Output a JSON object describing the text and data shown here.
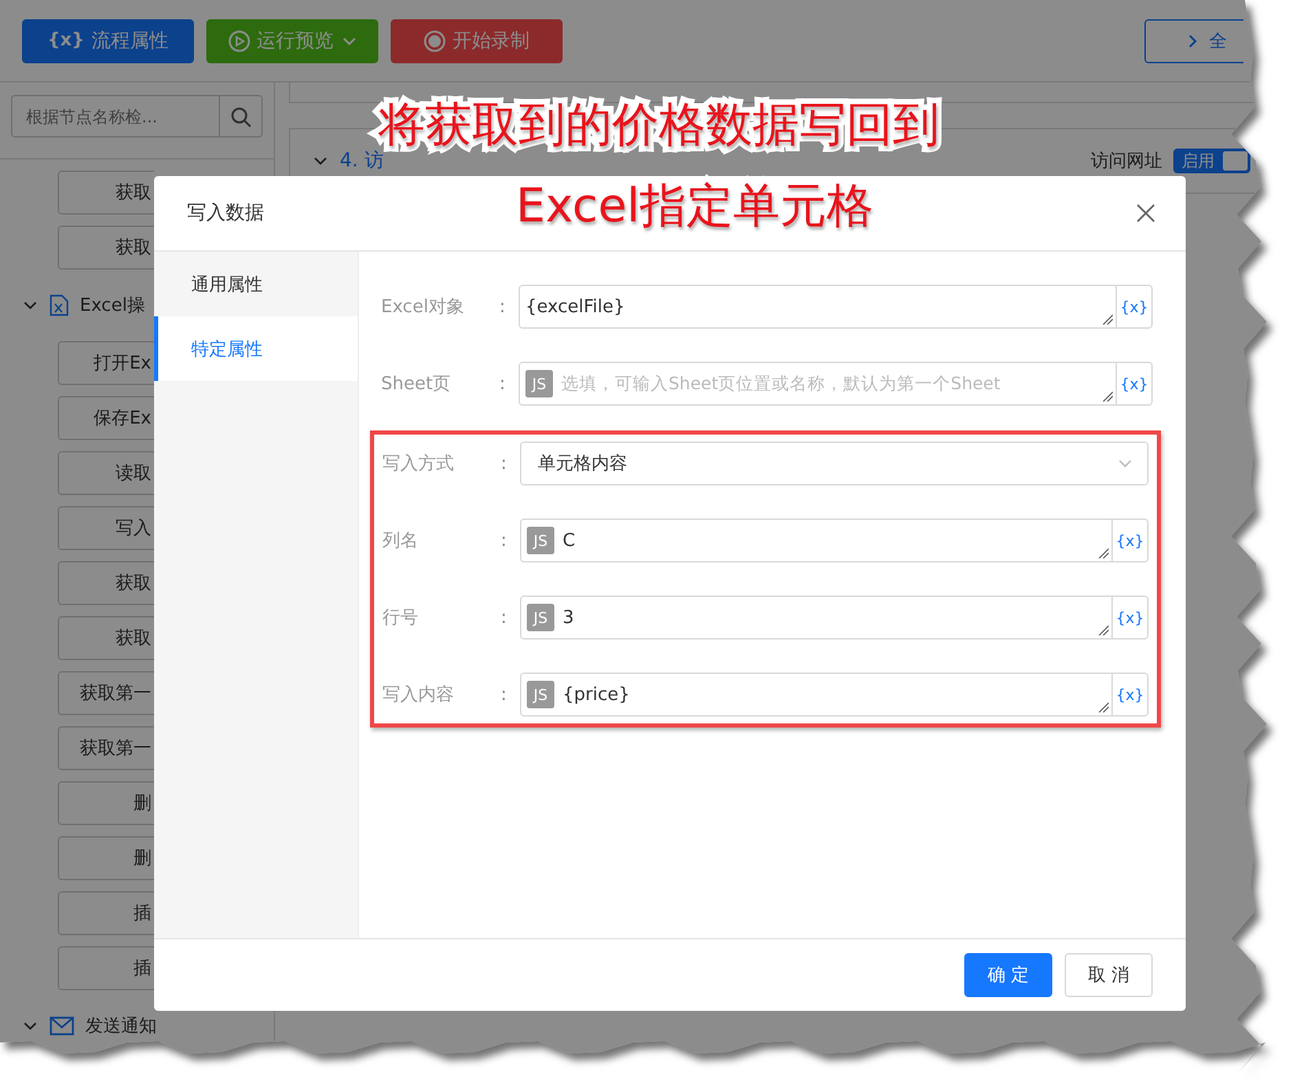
{
  "toolbar": {
    "buttons": [
      {
        "label": "流程属性",
        "brace": "{x}",
        "kind": "props"
      },
      {
        "label": "运行预览",
        "kind": "run"
      },
      {
        "label": "开始录制",
        "kind": "record"
      }
    ],
    "right_button": "全"
  },
  "sidebar": {
    "search": {
      "placeholder": "根据节点名称检..."
    },
    "items": [
      {
        "kind": "item",
        "label": "获取"
      },
      {
        "kind": "item",
        "label": "获取"
      },
      {
        "kind": "sheetgroup",
        "label": "Excel操",
        "expanded": true
      },
      {
        "kind": "item",
        "label": "打开Ex"
      },
      {
        "kind": "item",
        "label": "保存Ex"
      },
      {
        "kind": "item",
        "label": "读取"
      },
      {
        "kind": "item",
        "label": "写入"
      },
      {
        "kind": "item",
        "label": "获取"
      },
      {
        "kind": "item",
        "label": "获取"
      },
      {
        "kind": "item",
        "label": "获取第一"
      },
      {
        "kind": "item",
        "label": "获取第一"
      },
      {
        "kind": "item",
        "label": "删"
      },
      {
        "kind": "item",
        "label": "删"
      },
      {
        "kind": "item",
        "label": "插"
      },
      {
        "kind": "item",
        "label": "插"
      },
      {
        "kind": "mailgroup",
        "label": "发送通知",
        "expanded": true
      }
    ]
  },
  "steps": [
    {
      "title": "4. 访",
      "action": "访问网址",
      "toggle": "启用",
      "on": true
    }
  ],
  "dialog": {
    "title": "写入数据",
    "tabs": [
      {
        "label": "通用属性",
        "selected": false
      },
      {
        "label": "特定属性",
        "selected": true
      }
    ],
    "fields": [
      {
        "label": "Excel对象",
        "colon": ":",
        "kind": "text",
        "value": "{excelFile}",
        "var_button": "{x}",
        "highlighted": false
      },
      {
        "label": "Sheet页",
        "colon": ":",
        "kind": "js",
        "badge": "JS",
        "placeholder": "选填，可输入Sheet页位置或名称，默认为第一个Sheet",
        "var_button": "{x}",
        "highlighted": false
      },
      {
        "label": "写入方式",
        "colon": ":",
        "kind": "select",
        "value": "单元格内容",
        "highlighted": true
      },
      {
        "label": "列名",
        "colon": ":",
        "kind": "js",
        "badge": "JS",
        "value": "C",
        "var_button": "{x}",
        "highlighted": true
      },
      {
        "label": "行号",
        "colon": ":",
        "kind": "js",
        "badge": "JS",
        "value": "3",
        "var_button": "{x}",
        "highlighted": true
      },
      {
        "label": "写入内容",
        "colon": ":",
        "kind": "js",
        "badge": "JS",
        "value": "{price}",
        "var_button": "{x}",
        "highlighted": true
      }
    ],
    "buttons": [
      {
        "label": "确 定",
        "primary": true
      },
      {
        "label": "取 消",
        "primary": false
      }
    ]
  },
  "annotation": {
    "lines": [
      "将获取到的价格数据写回到",
      "Excel指定单元格"
    ]
  }
}
